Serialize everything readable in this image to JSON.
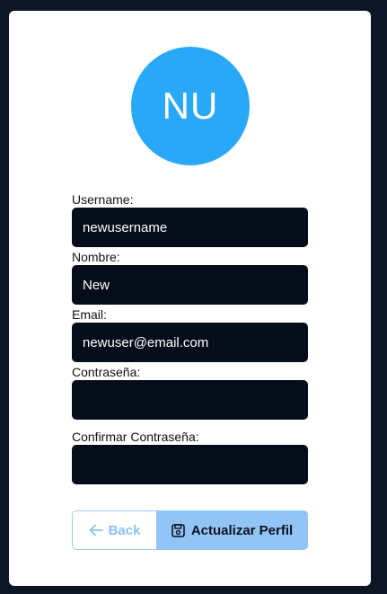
{
  "avatar": {
    "initials": "NU",
    "color": "#2aa8f8"
  },
  "form": {
    "username": {
      "label": "Username:",
      "value": "newusername"
    },
    "nombre": {
      "label": "Nombre:",
      "value": "New"
    },
    "email": {
      "label": "Email:",
      "value": "newuser@email.com"
    },
    "password": {
      "label": "Contraseña:",
      "value": ""
    },
    "confirm_password": {
      "label": "Confirmar Contraseña:",
      "value": ""
    }
  },
  "buttons": {
    "back_label": "Back",
    "back_icon": "arrow-left-icon",
    "update_label": "Actualizar Perfil",
    "update_icon": "save-icon"
  },
  "colors": {
    "page_bg": "#0c1624",
    "input_bg": "#050d1a",
    "accent": "#2aa8f8",
    "button_primary": "#93c4f6"
  }
}
